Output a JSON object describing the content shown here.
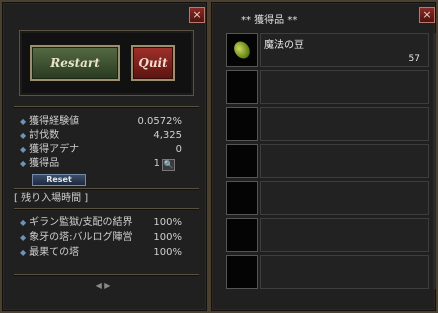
{
  "left": {
    "close_label": "×",
    "restart_label": "Restart",
    "quit_label": "Quit",
    "stats": [
      {
        "label": "獲得経験値",
        "value": "0.0572%"
      },
      {
        "label": "討伐数",
        "value": "4,325"
      },
      {
        "label": "獲得アデナ",
        "value": "0"
      },
      {
        "label": "獲得品",
        "value": "1"
      }
    ],
    "reset_label": "Reset",
    "remaining_header": "[ 残り入場時間 ]",
    "zones": [
      {
        "label": "ギラン監獄/支配の結界",
        "value": "100%"
      },
      {
        "label": "象牙の塔:バルログ陣営",
        "value": "100%"
      },
      {
        "label": "最果ての塔",
        "value": "100%"
      }
    ],
    "page_arrows": "◀ ▶"
  },
  "right": {
    "close_label": "×",
    "title": "** 獲得品 **",
    "items": [
      {
        "name": "魔法の豆",
        "count": "57",
        "icon": "magic-bean-icon"
      }
    ],
    "empty_slots": 6
  },
  "colors": {
    "panel_border": "#4a4032",
    "restart_green": "#556a44",
    "quit_red": "#a0302a",
    "bullet_blue": "#6e93b8"
  }
}
